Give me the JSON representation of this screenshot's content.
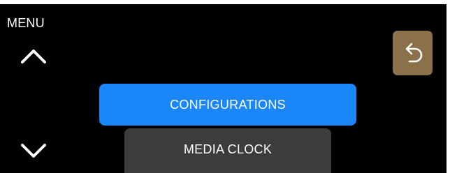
{
  "menu": {
    "title": "MENU",
    "selected_item": "CONFIGURATIONS",
    "next_item": "MEDIA CLOCK"
  },
  "icons": {
    "scroll_up": "chevron-up-icon",
    "scroll_down": "chevron-down-icon",
    "back": "back-arrow-icon"
  },
  "colors": {
    "background": "#000000",
    "selected": "#1a86f7",
    "unselected": "#3c3c3c",
    "back_button": "#8a7149",
    "text": "#ffffff"
  }
}
